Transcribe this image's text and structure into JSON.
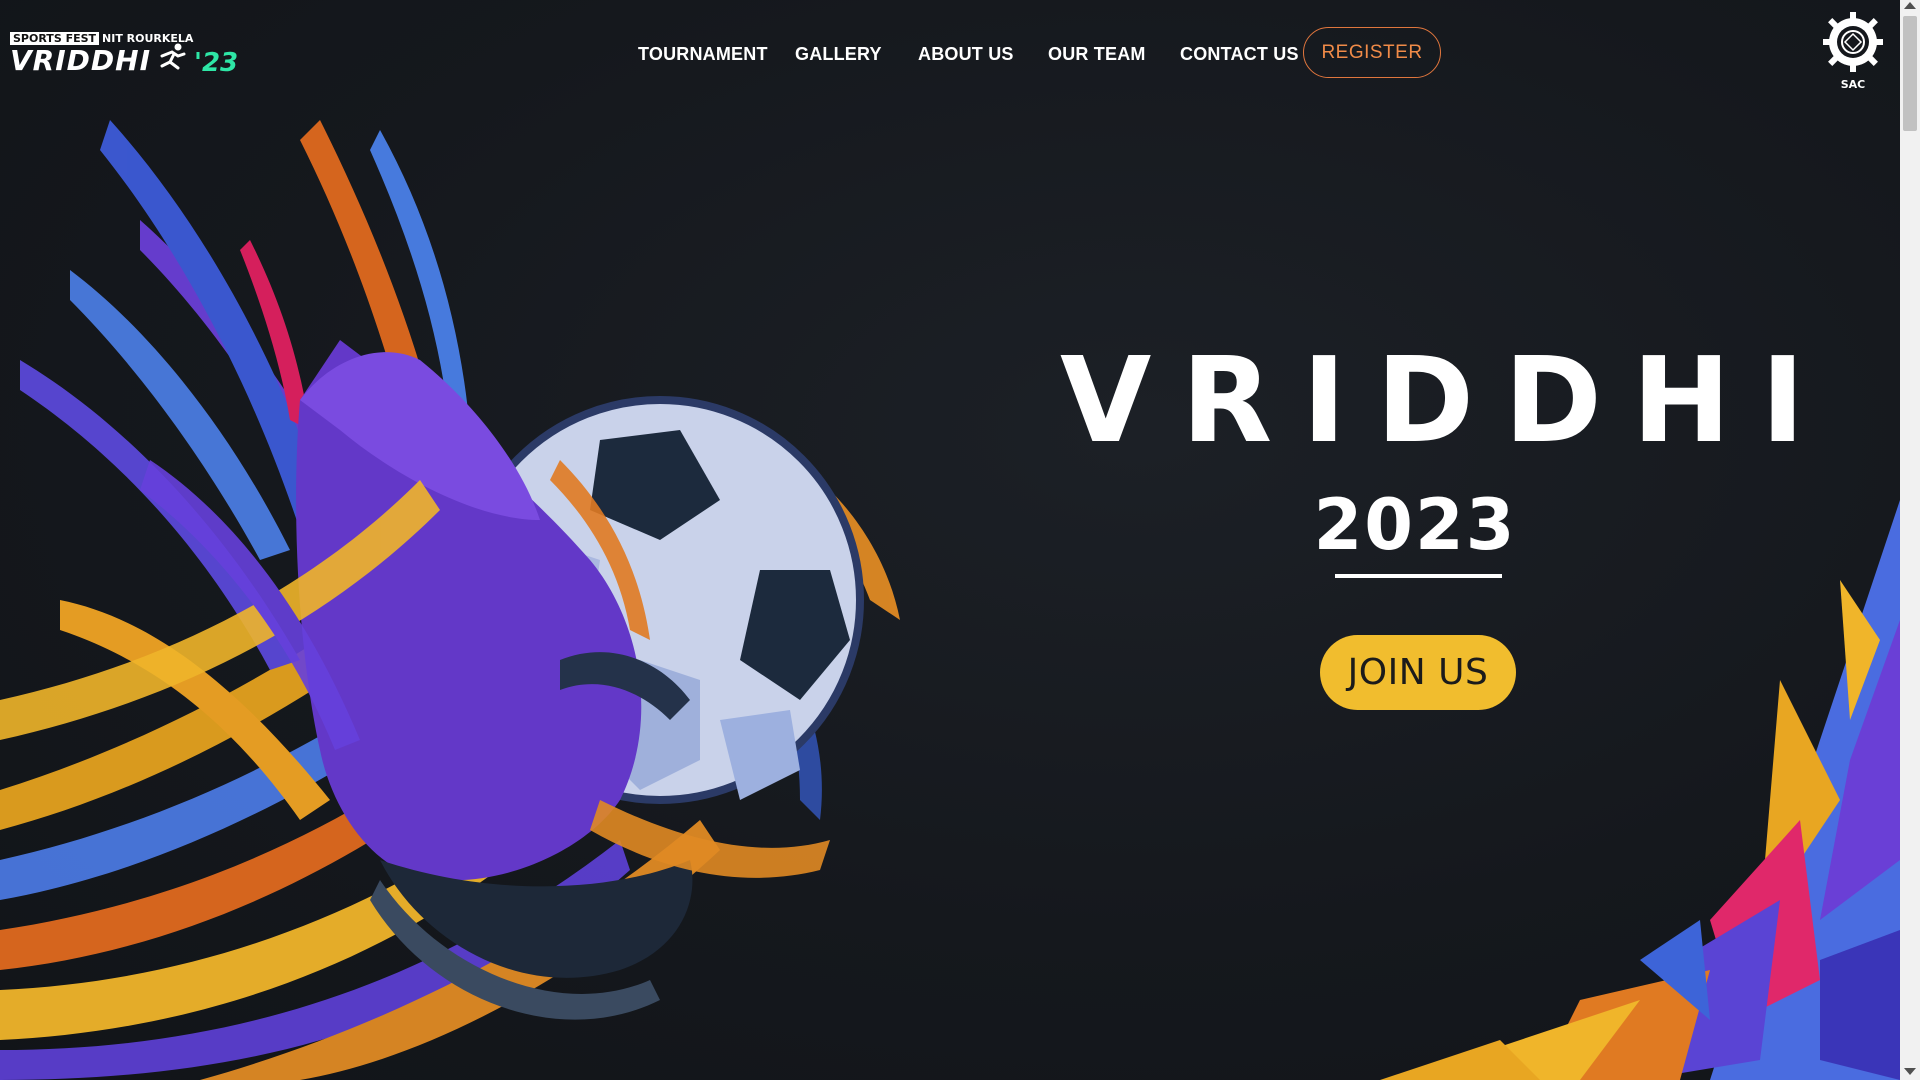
{
  "brand": {
    "tag_boxed": "SPORTS FEST",
    "tag_rest": "NIT ROURKELA",
    "wordmark": "VRIDDHI",
    "year_badge": "'23",
    "accent_color": "#2ee6a6"
  },
  "nav": {
    "items": [
      {
        "label": "TOURNAMENT"
      },
      {
        "label": "GALLERY"
      },
      {
        "label": "ABOUT US"
      },
      {
        "label": "OUR TEAM"
      },
      {
        "label": "CONTACT US"
      }
    ],
    "register_label": "REGISTER",
    "register_color": "#f08b48"
  },
  "emblem": {
    "label": "SAC",
    "icon": "gear-emblem-icon"
  },
  "hero": {
    "title": "VRIDDHI",
    "year": "2023",
    "cta_label": "JOIN US",
    "cta_color": "#f1bd2e",
    "art": "football-boot-and-ball-illustration"
  }
}
